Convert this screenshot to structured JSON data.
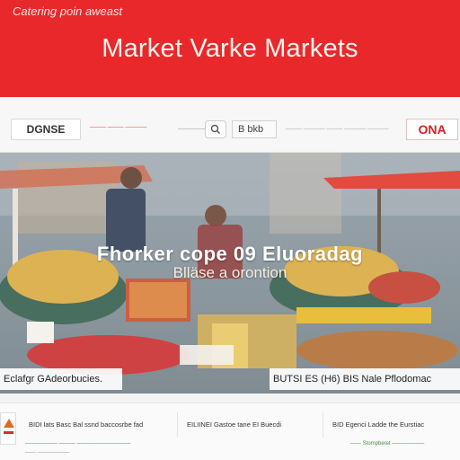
{
  "header": {
    "tagline": "Catering poin aweast",
    "site_title": "Market Varke Markets"
  },
  "navbar": {
    "logo_label": "DGNSE",
    "link_primary": "——— ——— ————",
    "link_secondary": "—————",
    "search_icon": "search-icon",
    "language_value": "B  bkb",
    "right_links": "———  ————  ———  ————  ————",
    "cta_label": "ONA"
  },
  "hero": {
    "title": "Fhorker cope 09 Eluoradag",
    "subtitle": "Blläse a orontion",
    "caption_left": "Eclafgr GAdeorbucies.",
    "caption_right": "BUTSI ES (H6) BIS Nale Pflodomac",
    "colors": {
      "awning": "#e03226",
      "pasta": "#d9a83c",
      "peppers": "#c8282a",
      "bins": "#2e5a48"
    }
  },
  "cards": {
    "icon": "market-logo-icon",
    "items": [
      {
        "text": "BIDI lats Basc Bal ssnd baccosrbe fad"
      },
      {
        "text": "EILIINEI Gastoe tane EI Buecdi"
      },
      {
        "text": "BID Egenci Ladde the Eurstiac"
      }
    ],
    "footer_left": "——————  ——— ——————————",
    "footer_left_2": "—— ——————",
    "footer_right": "——  Stompberet  ——————"
  }
}
